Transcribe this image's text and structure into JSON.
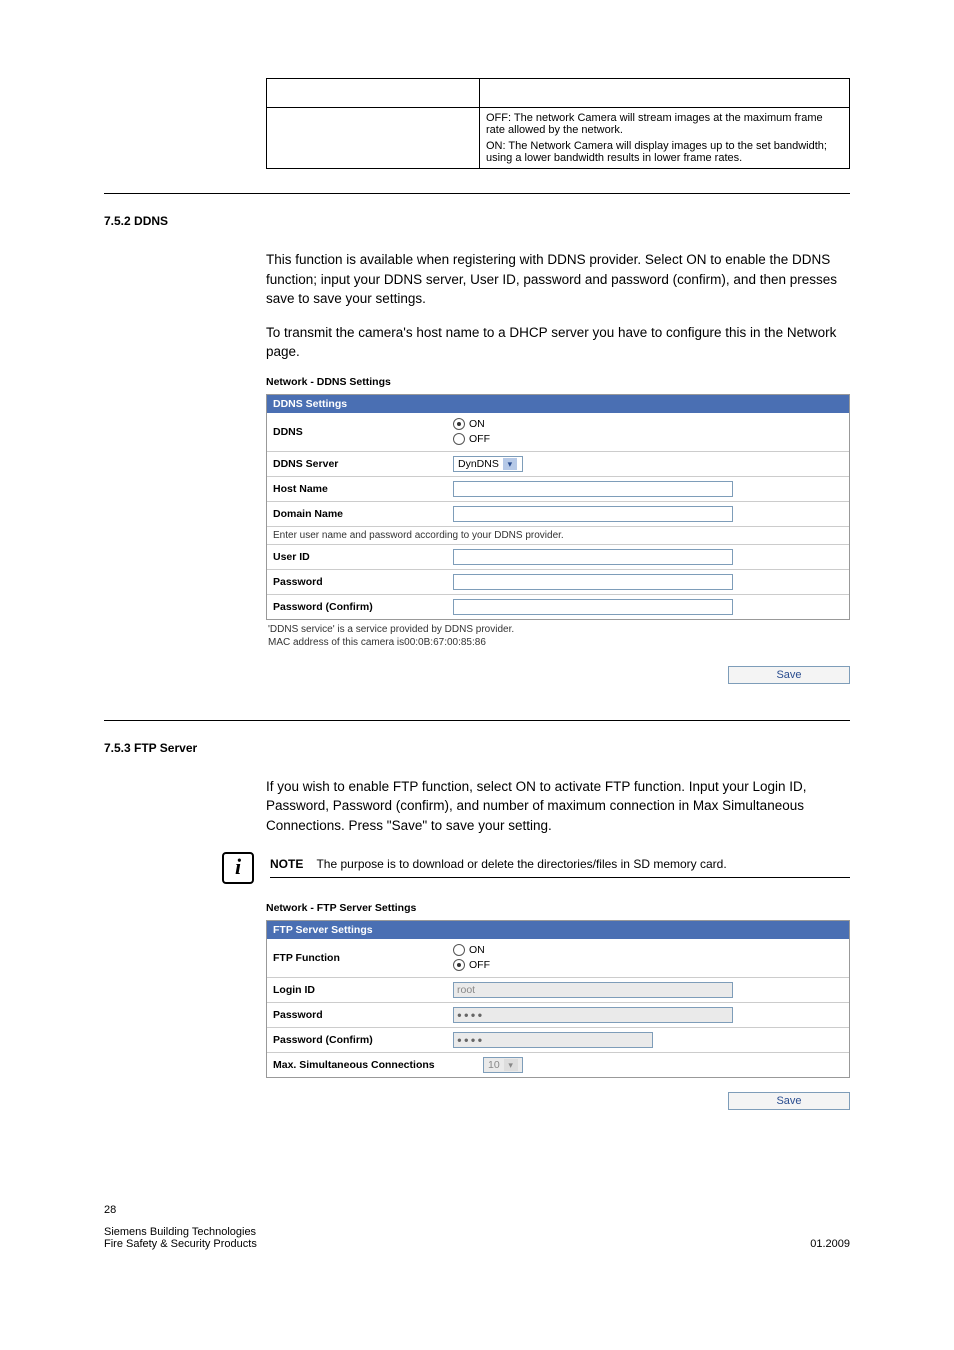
{
  "top_table": {
    "off_text": "OFF: The network Camera will stream images at the maximum frame rate allowed by the network.",
    "on_text": "ON: The Network Camera will display images up to the set bandwidth; using a lower bandwidth results in lower frame rates."
  },
  "ddns_section": {
    "heading": "7.5.2  DDNS",
    "para1": "This function is available when registering with DDNS provider. Select ON to enable the DDNS function; input your DDNS server, User ID, password and password (confirm), and then presses save to save your settings.",
    "para2_a": "To transmit the camera's host name to a DHCP server you have to configure this in the ",
    "para2_link": "Network page",
    "para2_b": ".",
    "sc_title": "Network - DDNS Settings",
    "panel_header": "DDNS Settings",
    "rows": {
      "ddns_label": "DDNS",
      "on": "ON",
      "off": "OFF",
      "server_label": "DDNS Server",
      "server_value": "DynDNS",
      "host_label": "Host Name",
      "domain_label": "Domain Name",
      "note1": "Enter user name and password according to your DDNS provider.",
      "userid_label": "User ID",
      "pw_label": "Password",
      "pwc_label": "Password (Confirm)"
    },
    "foot1": "'DDNS service' is a service provided by DDNS provider.",
    "foot2": "MAC address of this camera is00:0B:67:00:85:86",
    "save": "Save"
  },
  "ftp_section": {
    "heading": "7.5.3  FTP Server",
    "para1": "If you wish to enable FTP function, select ON to activate FTP function. Input your Login ID, Password, Password (confirm), and number of maximum connection in Max Simultaneous Connections. Press \"Save\" to save your setting.",
    "note_label": "NOTE",
    "note_text": "The purpose is to download or delete the directories/files in SD memory card.",
    "sc_title": "Network - FTP Server Settings",
    "panel_header": "FTP Server Settings",
    "rows": {
      "func_label": "FTP Function",
      "on": "ON",
      "off": "OFF",
      "login_label": "Login ID",
      "login_value": "root",
      "pw_label": "Password",
      "pw_value": "●●●●",
      "pwc_label": "Password (Confirm)",
      "pwc_value": "●●●●",
      "max_label": "Max. Simultaneous Connections",
      "max_value": "10"
    },
    "save": "Save"
  },
  "footer": {
    "page_num": "28",
    "left1": "Siemens Building Technologies",
    "left2": "Fire Safety & Security Products",
    "right": "01.2009"
  }
}
